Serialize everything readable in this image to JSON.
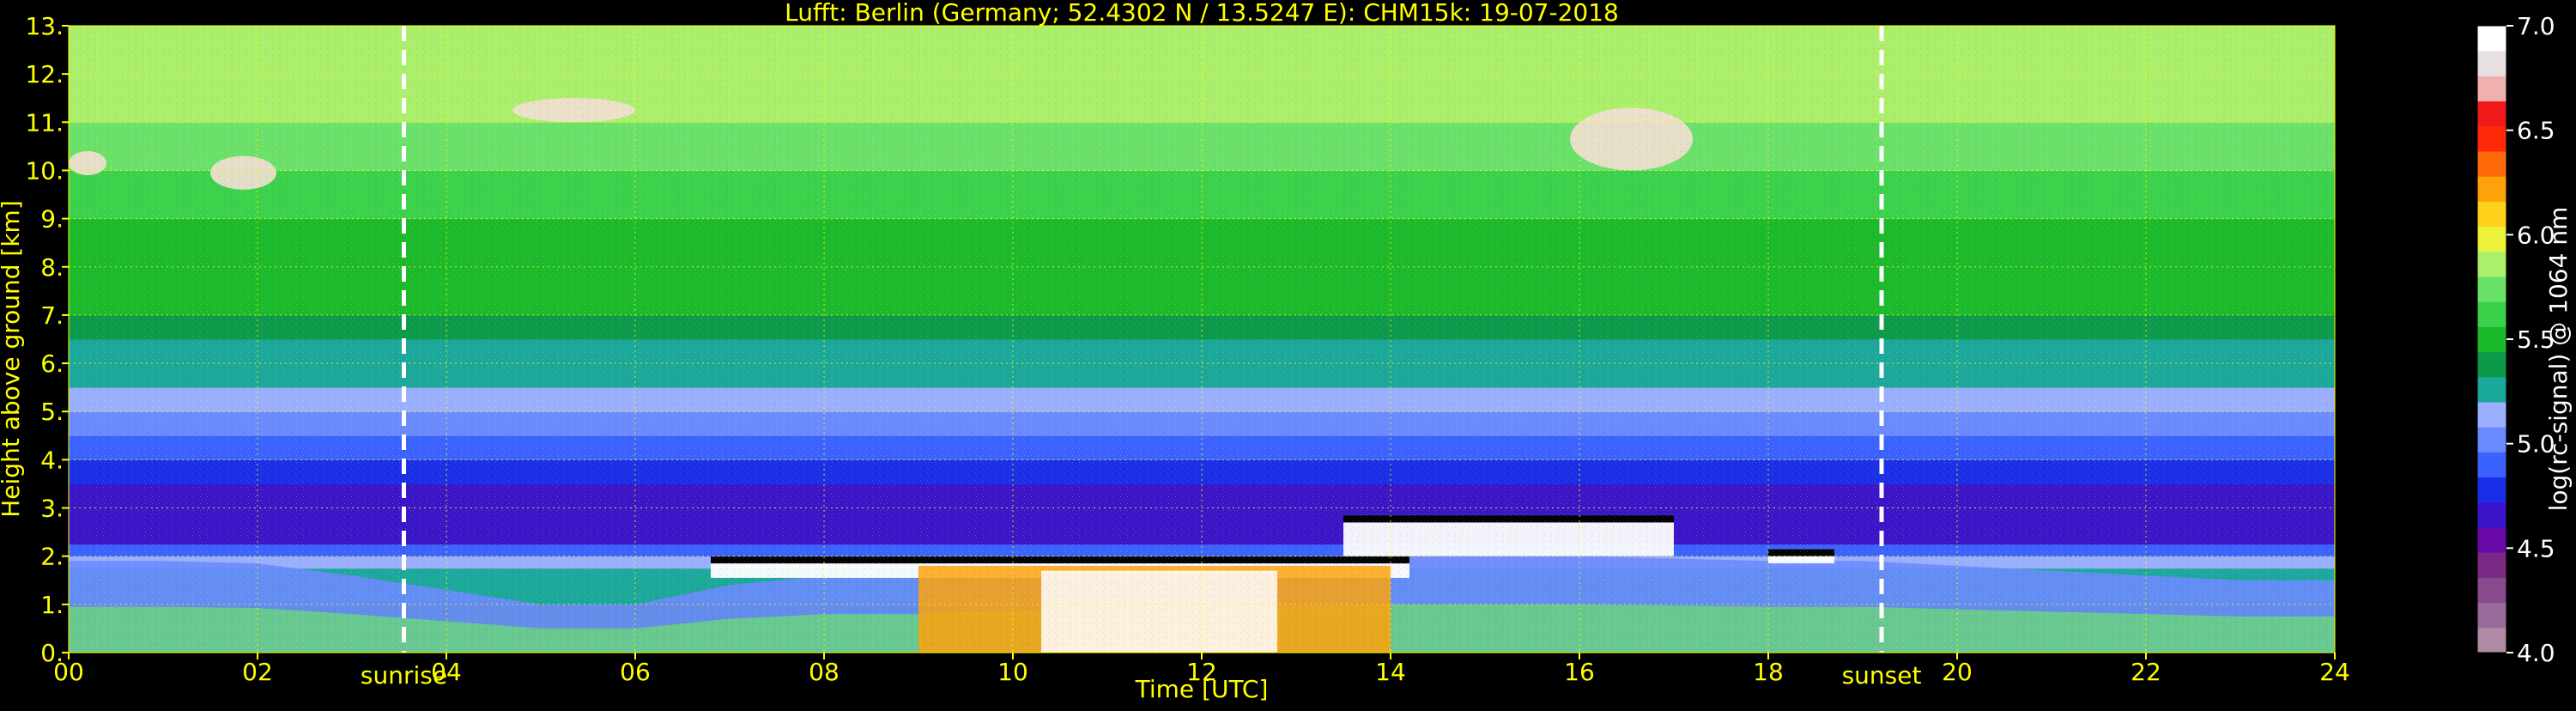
{
  "figure": {
    "title": "Lufft: Berlin (Germany; 52.4302 N / 13.5247 E):    CHM15k: 19-07-2018",
    "text_color": "#ffff00",
    "colorbar_text_color": "#ffffff",
    "background": "#000000"
  },
  "chart_data": {
    "type": "heatmap",
    "title": "Lufft: Berlin (Germany; 52.4302 N / 13.5247 E):    CHM15k: 19-07-2018",
    "xlabel": "Time [UTC]",
    "ylabel": "Height above ground [km]",
    "xlim": [
      0,
      24
    ],
    "ylim": [
      0,
      13
    ],
    "x_ticks": [
      0,
      2,
      4,
      6,
      8,
      10,
      12,
      14,
      16,
      18,
      20,
      22,
      24
    ],
    "x_tick_labels": [
      "00",
      "02",
      "04",
      "06",
      "08",
      "10",
      "12",
      "14",
      "16",
      "18",
      "20",
      "22",
      "24"
    ],
    "y_ticks": [
      0,
      1,
      2,
      3,
      4,
      5,
      6,
      7,
      8,
      9,
      10,
      11,
      12,
      13
    ],
    "y_tick_labels": [
      "0.",
      "1.",
      "2.",
      "3.",
      "4.",
      "5.",
      "6.",
      "7.",
      "8.",
      "9.",
      "10.",
      "11.",
      "12.",
      "13."
    ],
    "grid": true,
    "grid_color": "#ffff00",
    "annotations": [
      {
        "label": "sunrise",
        "x": 3.55
      },
      {
        "label": "sunset",
        "x": 19.2
      }
    ],
    "colorbar": {
      "label": "log(rc-signal) @ 1064 nm",
      "range": [
        4.0,
        7.0
      ],
      "ticks": [
        4.0,
        4.5,
        5.0,
        5.5,
        6.0,
        6.5,
        7.0
      ],
      "tick_labels": [
        "4.0",
        "4.5",
        "5.0",
        "5.5",
        "6.0",
        "6.5",
        "7.0"
      ],
      "colors": [
        "#b08aa4",
        "#9a6a9a",
        "#8a4a8e",
        "#7a2a84",
        "#6a0aa8",
        "#3a14c8",
        "#1a2ee8",
        "#3a62ff",
        "#6a8aff",
        "#9ab0ff",
        "#1aa89a",
        "#0a9a4a",
        "#1aba2a",
        "#3ad24a",
        "#6ae26a",
        "#aaf06a",
        "#eaf23a",
        "#ffd21a",
        "#ffa20a",
        "#ff6a0a",
        "#ff2a0a",
        "#f01a1a",
        "#f0b0b0",
        "#e8e0e0",
        "#ffffff"
      ]
    },
    "height_profile": {
      "heights": [
        0.0,
        0.25,
        0.5,
        0.75,
        1.0,
        1.25,
        1.5,
        1.75,
        2.0,
        2.25,
        2.5,
        3.0,
        3.5,
        4.0,
        4.5,
        5.0,
        5.5,
        6.0,
        6.5,
        7.0,
        7.5,
        8.0,
        9.0,
        10.0,
        11.0,
        12.0,
        13.0
      ],
      "signal": [
        5.55,
        5.5,
        5.45,
        5.4,
        5.3,
        5.25,
        5.2,
        5.15,
        4.85,
        4.7,
        4.65,
        4.7,
        4.8,
        4.9,
        5.0,
        5.1,
        5.2,
        5.3,
        5.4,
        5.45,
        5.5,
        5.55,
        5.6,
        5.7,
        5.8,
        5.9,
        6.0
      ]
    },
    "features": [
      {
        "type": "boundary_layer",
        "x": [
          0.0,
          1.0,
          2.0,
          3.0,
          4.0,
          5.0,
          6.0,
          7.0,
          8.0,
          9.0,
          10.0,
          11.0,
          12.0,
          13.0,
          14.0,
          15.0,
          16.0,
          17.0,
          18.0,
          19.0,
          20.0,
          21.0,
          22.0,
          23.0,
          24.0
        ],
        "top_km": [
          1.9,
          1.9,
          1.85,
          1.6,
          1.3,
          1.0,
          1.0,
          1.4,
          1.6,
          1.6,
          1.75,
          1.75,
          1.7,
          1.9,
          2.0,
          2.0,
          2.0,
          1.95,
          1.9,
          1.9,
          1.8,
          1.7,
          1.6,
          1.5,
          1.5
        ]
      },
      {
        "type": "cloud_layer",
        "x_start": 6.8,
        "x_end": 14.2,
        "base_km": 1.55,
        "top_km": 1.85
      },
      {
        "type": "cloud_layer",
        "x_start": 13.5,
        "x_end": 17.0,
        "base_km": 2.0,
        "top_km": 2.7
      },
      {
        "type": "cloud_layer",
        "x_start": 18.0,
        "x_end": 18.7,
        "base_km": 1.85,
        "top_km": 2.0
      },
      {
        "type": "convective_plume",
        "x_start": 9.0,
        "x_end": 14.0,
        "base_km": 0.0,
        "top_km": 1.8
      },
      {
        "type": "high_cloud",
        "x_start": 4.7,
        "x_end": 6.0,
        "base_km": 11.0,
        "top_km": 11.5
      },
      {
        "type": "high_cloud",
        "x_start": 0.0,
        "x_end": 0.4,
        "base_km": 9.9,
        "top_km": 10.4
      },
      {
        "type": "high_cloud",
        "x_start": 1.5,
        "x_end": 2.2,
        "base_km": 9.6,
        "top_km": 10.3
      },
      {
        "type": "high_cloud",
        "x_start": 15.9,
        "x_end": 17.2,
        "base_km": 10.0,
        "top_km": 11.3
      }
    ]
  }
}
